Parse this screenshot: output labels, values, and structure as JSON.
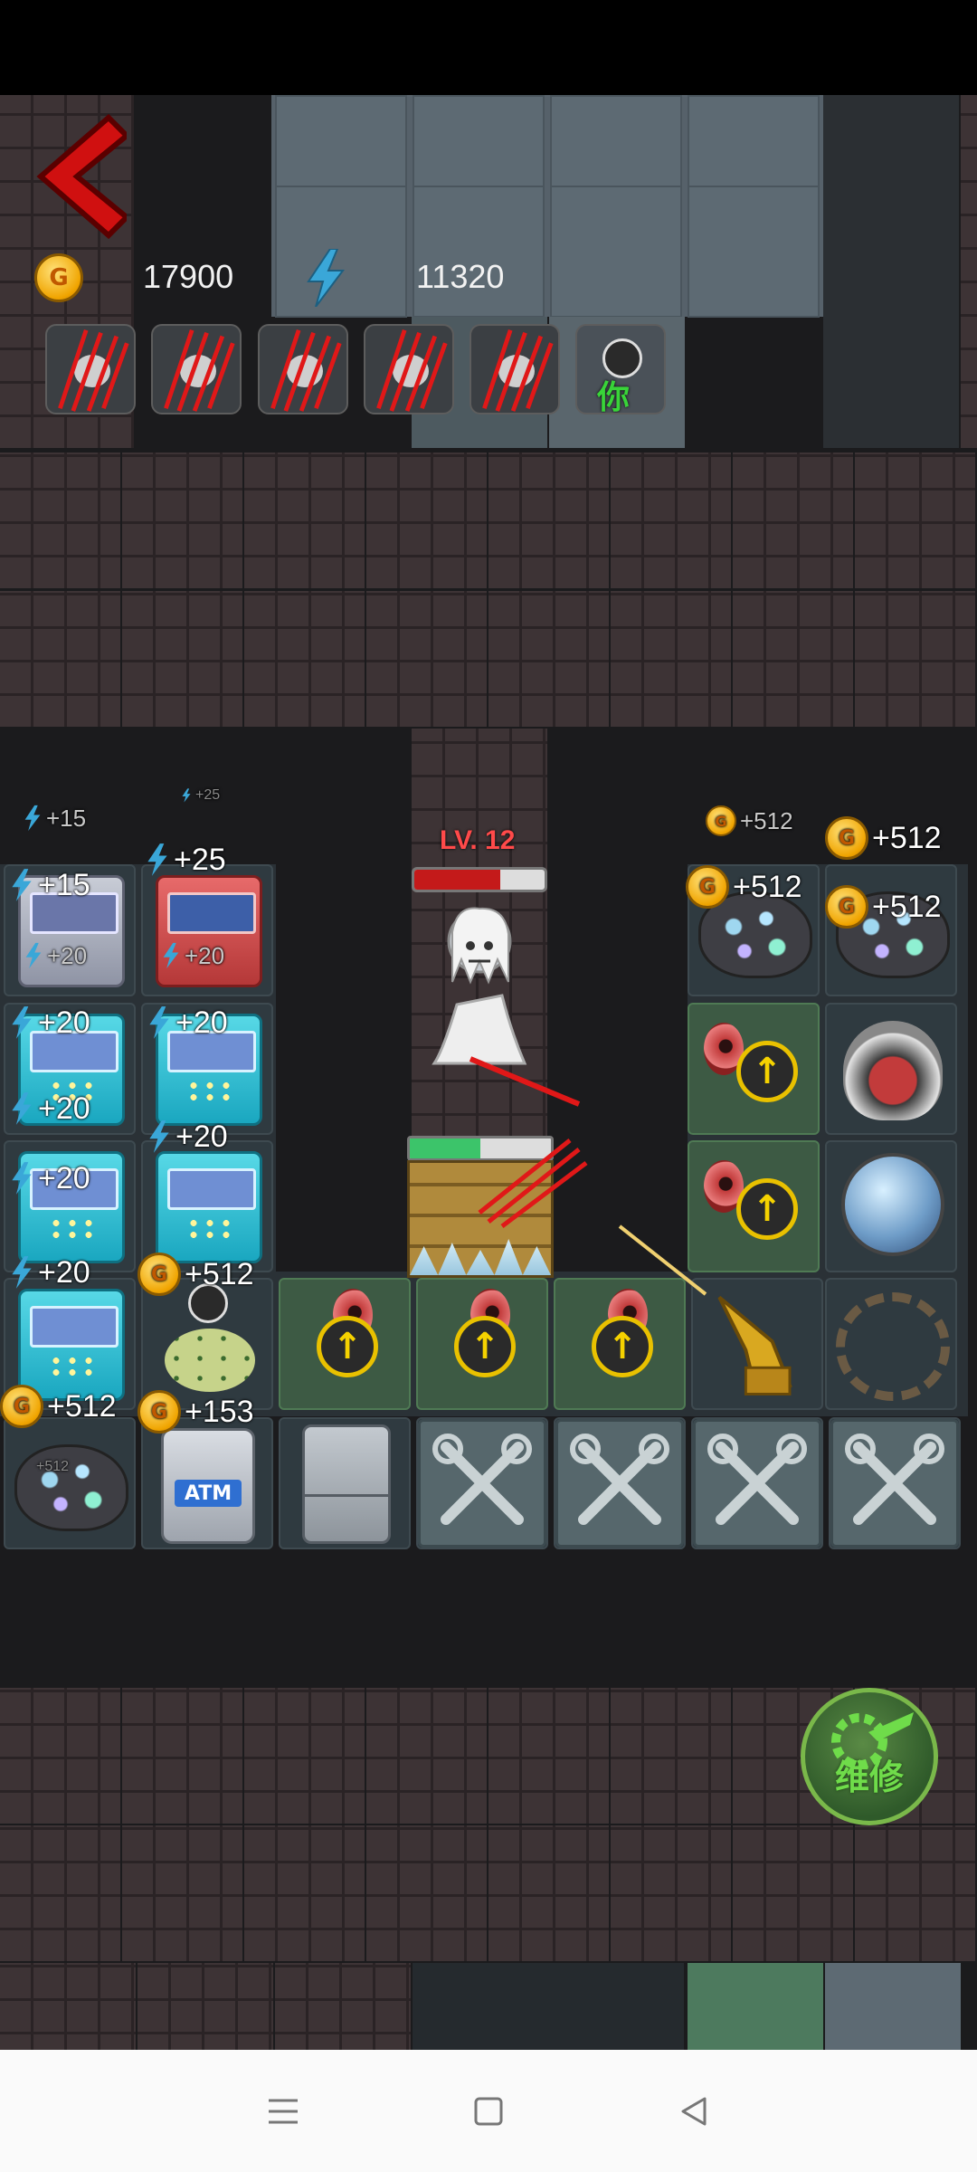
{
  "hud": {
    "gold": "17900",
    "energy": "11320",
    "coin_symbol": "G",
    "you_label": "你"
  },
  "players": [
    "ghost-claw-icon",
    "ghost-claw-icon",
    "ghost-claw-icon",
    "ghost-claw-icon",
    "ghost-claw-icon",
    "you-avatar-icon"
  ],
  "bonuses": {
    "left_header": "+15",
    "left_header_small": "+25",
    "right_header_small": "+512",
    "right_header": "+512",
    "c1r1": "+15",
    "c1r1_sub": "+20",
    "c2r1": "+25",
    "c2r1_sub": "+20",
    "c1r2": "+20",
    "c2r2": "+20",
    "c1r3_top": "+20",
    "c1r3": "+20",
    "c2r3": "+20",
    "c1r4": "+20",
    "c2r4": "+512",
    "c1r5": "+512",
    "c1r5_sub": "+512",
    "c2r5": "+153",
    "r5r1": "+512",
    "r6r1": "+512"
  },
  "enemy": {
    "level": "LV. 12",
    "hp_fraction": 0.66,
    "door_hp_fraction": 0.5
  },
  "machines": {
    "atm_label": "ATM"
  },
  "repair": {
    "label": "维修"
  },
  "colors": {
    "gold_coin": "#f0a400",
    "energy_bolt": "#3aa7d8",
    "enemy_level": "#ff4a4a",
    "repair_green": "#6fdc4a",
    "back_arrow": "#d01010"
  }
}
